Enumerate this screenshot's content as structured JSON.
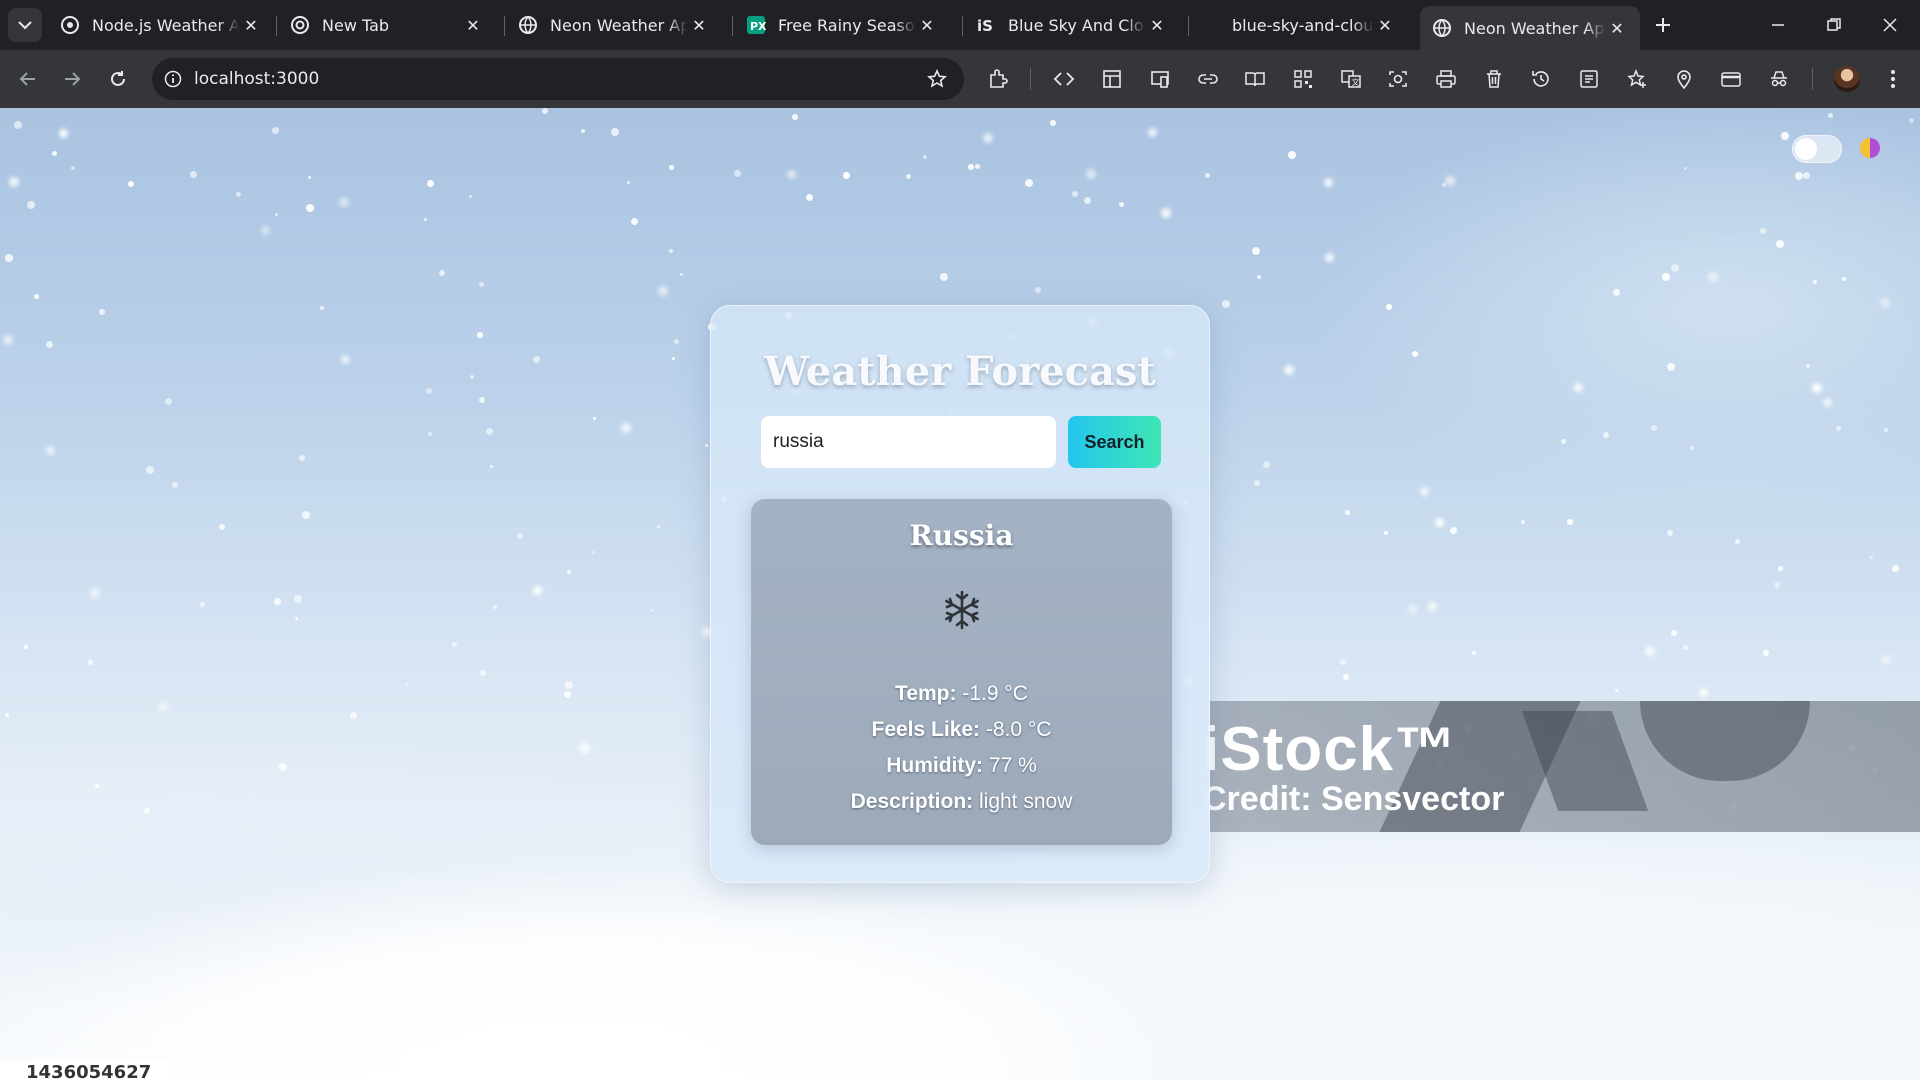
{
  "browser": {
    "tabs": [
      {
        "title": "Node.js Weather API",
        "favicon": "openai-icon",
        "active": false
      },
      {
        "title": "New Tab",
        "favicon": "chrome-icon",
        "active": false
      },
      {
        "title": "Neon Weather App",
        "favicon": "globe-icon",
        "active": false
      },
      {
        "title": "Free Rainy Season Ve",
        "favicon": "pexels-icon",
        "active": false
      },
      {
        "title": "Blue Sky And Clouds",
        "favicon": "istock-icon",
        "active": false
      },
      {
        "title": "blue-sky-and-clouds",
        "favicon": "",
        "active": false
      },
      {
        "title": "Neon Weather App",
        "favicon": "globe-icon",
        "active": true
      }
    ],
    "url": "localhost:3000"
  },
  "page": {
    "card": {
      "title": "Weather Forecast",
      "search": {
        "value": "russia",
        "button_label": "Search"
      }
    },
    "result": {
      "city": "Russia",
      "icon": "snowflake-icon",
      "temp_label": "Temp:",
      "temp_value": "-1.9 °C",
      "feels_label": "Feels Like:",
      "feels_value": "-8.0 °C",
      "humidity_label": "Humidity:",
      "humidity_value": "77 %",
      "description_label": "Description:",
      "description_value": "light snow"
    },
    "watermark": {
      "brand": "iStock™",
      "credit": "Credit: Sensvector"
    },
    "image_id": "1436054627"
  },
  "colors": {
    "search_button_start": "#22c6ee",
    "search_button_end": "#3ee6b4",
    "card_bg": "#d6e8f8",
    "result_bg": "#a0afc0"
  }
}
